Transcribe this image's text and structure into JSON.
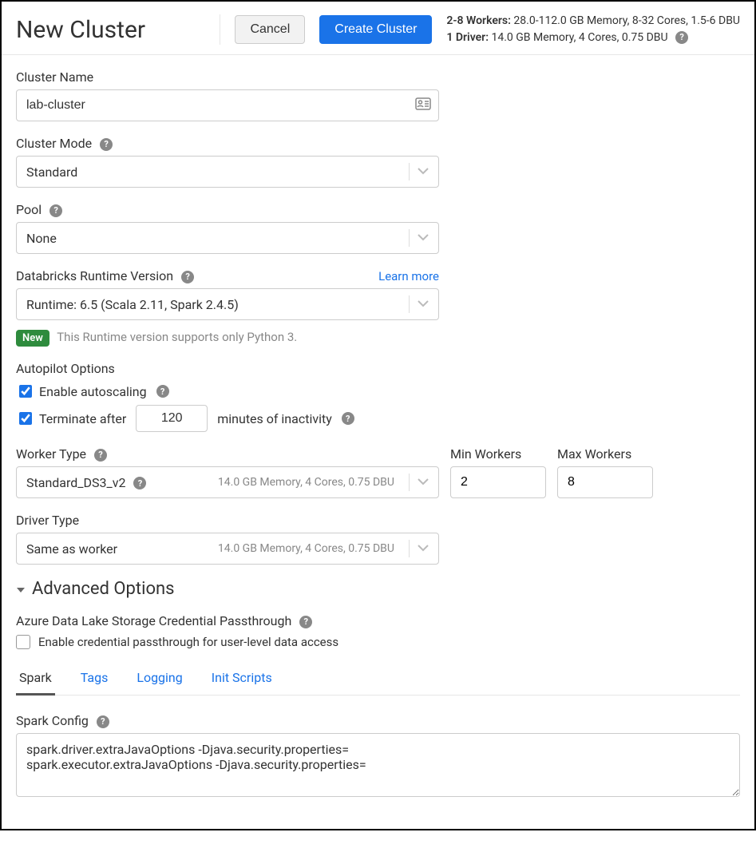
{
  "header": {
    "title": "New Cluster",
    "cancel": "Cancel",
    "create": "Create Cluster",
    "summary": {
      "workers_label": "2-8 Workers:",
      "workers_detail": "28.0-112.0 GB Memory, 8-32 Cores, 1.5-6 DBU",
      "driver_label": "1 Driver:",
      "driver_detail": "14.0 GB Memory, 4 Cores, 0.75 DBU"
    }
  },
  "cluster_name": {
    "label": "Cluster Name",
    "value": "lab-cluster"
  },
  "cluster_mode": {
    "label": "Cluster Mode",
    "value": "Standard"
  },
  "pool": {
    "label": "Pool",
    "value": "None"
  },
  "runtime": {
    "label": "Databricks Runtime Version",
    "learn_more": "Learn more",
    "value": "Runtime: 6.5 (Scala 2.11, Spark 2.4.5)",
    "badge": "New",
    "note": "This Runtime version supports only Python 3."
  },
  "autopilot": {
    "title": "Autopilot Options",
    "enable_autoscaling": "Enable autoscaling",
    "terminate_prefix": "Terminate after",
    "terminate_minutes": "120",
    "terminate_suffix": "minutes of inactivity"
  },
  "worker": {
    "label": "Worker Type",
    "value": "Standard_DS3_v2",
    "info": "14.0 GB Memory, 4 Cores, 0.75 DBU",
    "min_label": "Min Workers",
    "min_value": "2",
    "max_label": "Max Workers",
    "max_value": "8"
  },
  "driver": {
    "label": "Driver Type",
    "value": "Same as worker",
    "info": "14.0 GB Memory, 4 Cores, 0.75 DBU"
  },
  "advanced": {
    "title": "Advanced Options",
    "adls_label": "Azure Data Lake Storage Credential Passthrough",
    "adls_checkbox": "Enable credential passthrough for user-level data access"
  },
  "tabs": {
    "spark": "Spark",
    "tags": "Tags",
    "logging": "Logging",
    "init_scripts": "Init Scripts"
  },
  "spark_config": {
    "label": "Spark Config",
    "value": "spark.driver.extraJavaOptions -Djava.security.properties=\nspark.executor.extraJavaOptions -Djava.security.properties="
  }
}
